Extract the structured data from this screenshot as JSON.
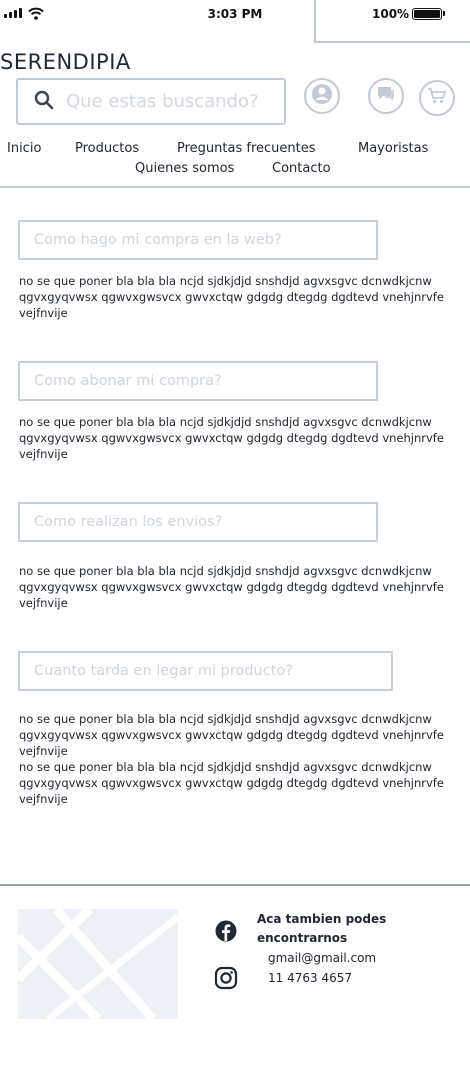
{
  "status_bar": {
    "time": "3:03 PM",
    "battery": "100%"
  },
  "header": {
    "brand": "SERENDIPIA",
    "search_placeholder": "Que estas buscando?"
  },
  "nav": {
    "items": [
      "Inicio",
      "Productos",
      "Preguntas frecuentes",
      "Mayoristas",
      "Quienes somos",
      "Contacto"
    ]
  },
  "faq": [
    {
      "question": "Como hago mi compra en la web?",
      "answer": [
        "no se que poner bla bla bla ncjd sjdkjdjd snshdjd agvxsgvc dcnwdkjcnw qgvxgyqvwsx qgwvxgwsvcx gwvxctqw gdgdg dtegdg dgdtevd vnehjnrvfe vejfnvije"
      ]
    },
    {
      "question": "Como abonar mi compra?",
      "answer": [
        "no se que poner bla bla bla ncjd sjdkjdjd snshdjd agvxsgvc dcnwdkjcnw qgvxgyqvwsx qgwvxgwsvcx gwvxctqw gdgdg dtegdg dgdtevd vnehjnrvfe vejfnvije"
      ]
    },
    {
      "question": "Como realizan los envios?",
      "answer": [
        "no se que poner bla bla bla ncjd sjdkjdjd snshdjd agvxsgvc dcnwdkjcnw qgvxgyqvwsx qgwvxgwsvcx gwvxctqw gdgdg dtegdg dgdtevd vnehjnrvfe vejfnvije"
      ]
    },
    {
      "question": "Cuanto tarda en legar mi producto?",
      "answer": [
        "no se que poner bla bla bla ncjd sjdkjdjd snshdjd agvxsgvc dcnwdkjcnw qgvxgyqvwsx qgwvxgwsvcx gwvxctqw gdgdg dtegdg dgdtevd vnehjnrvfe vejfnvije",
        "no se que poner bla bla bla ncjd sjdkjdjd snshdjd agvxsgvc dcnwdkjcnw qgvxgyqvwsx qgwvxgwsvcx gwvxctqw gdgdg dtegdg dgdtevd vnehjnrvfe vejfnvije"
      ]
    }
  ],
  "footer": {
    "heading": "Aca tambien podes encontrarnos",
    "email": "gmail@gmail.com",
    "phone": "11 4763 4657"
  },
  "icons": [
    "signal-icon",
    "wifi-icon",
    "battery-icon",
    "search-icon",
    "user-icon",
    "chat-icon",
    "cart-icon",
    "map-placeholder",
    "facebook-icon",
    "instagram-icon"
  ],
  "colors": {
    "border": "#c4cad3",
    "placeholder": "#d3d8df",
    "text": "#222831",
    "map_bg": "#edf0f4"
  }
}
